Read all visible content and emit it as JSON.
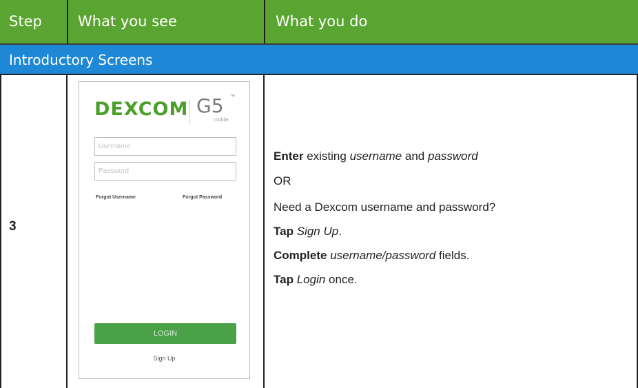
{
  "header": {
    "step": "Step",
    "what_you_see": "What you see",
    "what_you_do": "What you do"
  },
  "section": {
    "title": "Introductory Screens"
  },
  "row": {
    "step_number": "3",
    "phone": {
      "logo_dexcom": "DEXCOM",
      "logo_g5": "G5",
      "logo_tm": "™",
      "logo_mobile": "mobile",
      "username_placeholder": "Username",
      "password_placeholder": "Password",
      "forgot_username": "Forgot Username",
      "forgot_password": "Forgot Password",
      "login_label": "LOGIN",
      "signup_label": "Sign Up"
    },
    "instructions": {
      "line1_bold": "Enter",
      "line1_mid": " existing ",
      "line1_it1": "username",
      "line1_and": " and ",
      "line1_it2": "password",
      "line2": "OR",
      "line3": "Need a Dexcom username and password?",
      "line4_bold": "Tap",
      "line4_it": "Sign Up",
      "line4_end": ".",
      "line5_bold": "Complete",
      "line5_it": "username/password",
      "line5_end": " fields.",
      "line6_bold": "Tap",
      "line6_it": "Login",
      "line6_end": " once."
    }
  },
  "colors": {
    "header_green": "#5aa431",
    "section_blue": "#1e88d6",
    "logo_green": "#4a9e2a",
    "login_green": "#4aa148"
  }
}
